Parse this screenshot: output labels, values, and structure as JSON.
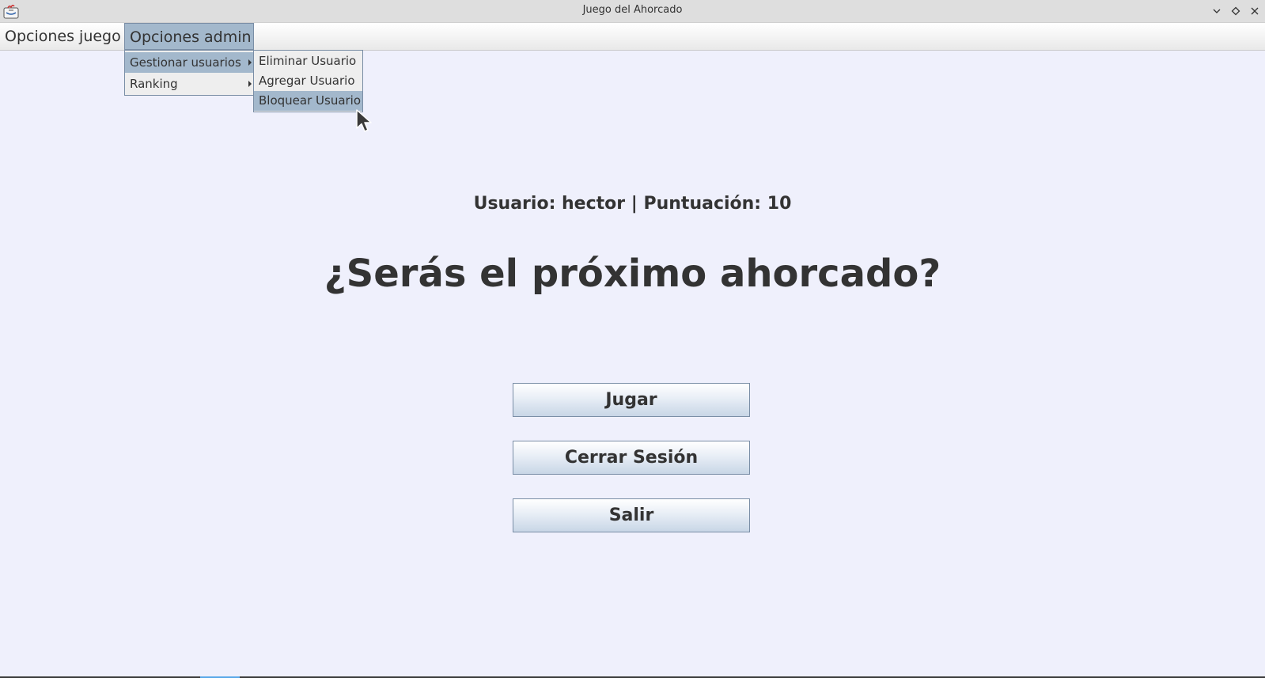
{
  "window": {
    "title": "Juego del Ahorcado",
    "icon": "java-app-icon",
    "controls": [
      "minimize-icon",
      "maximize-icon",
      "close-icon"
    ]
  },
  "menubar": {
    "items": [
      {
        "label": "Opciones juego",
        "active": false
      },
      {
        "label": "Opciones admin",
        "active": true
      }
    ]
  },
  "admin_menu": {
    "items": [
      {
        "label": "Gestionar usuarios",
        "selected": true,
        "has_submenu": true
      },
      {
        "label": "Ranking",
        "selected": false,
        "has_submenu": true
      }
    ]
  },
  "users_submenu": {
    "items": [
      {
        "label": "Eliminar Usuario",
        "selected": false
      },
      {
        "label": "Agregar Usuario",
        "selected": false
      },
      {
        "label": "Bloquear Usuario",
        "selected": true
      }
    ]
  },
  "main": {
    "user_info": "Usuario: hector | Puntuación: 10",
    "headline": "¿Serás el próximo ahorcado?",
    "buttons": {
      "play": "Jugar",
      "logout": "Cerrar Sesión",
      "exit": "Salir"
    }
  },
  "colors": {
    "background": "#eff0fc",
    "selection": "#a3b8cc",
    "border": "#7a8ea6",
    "text": "#333333"
  }
}
